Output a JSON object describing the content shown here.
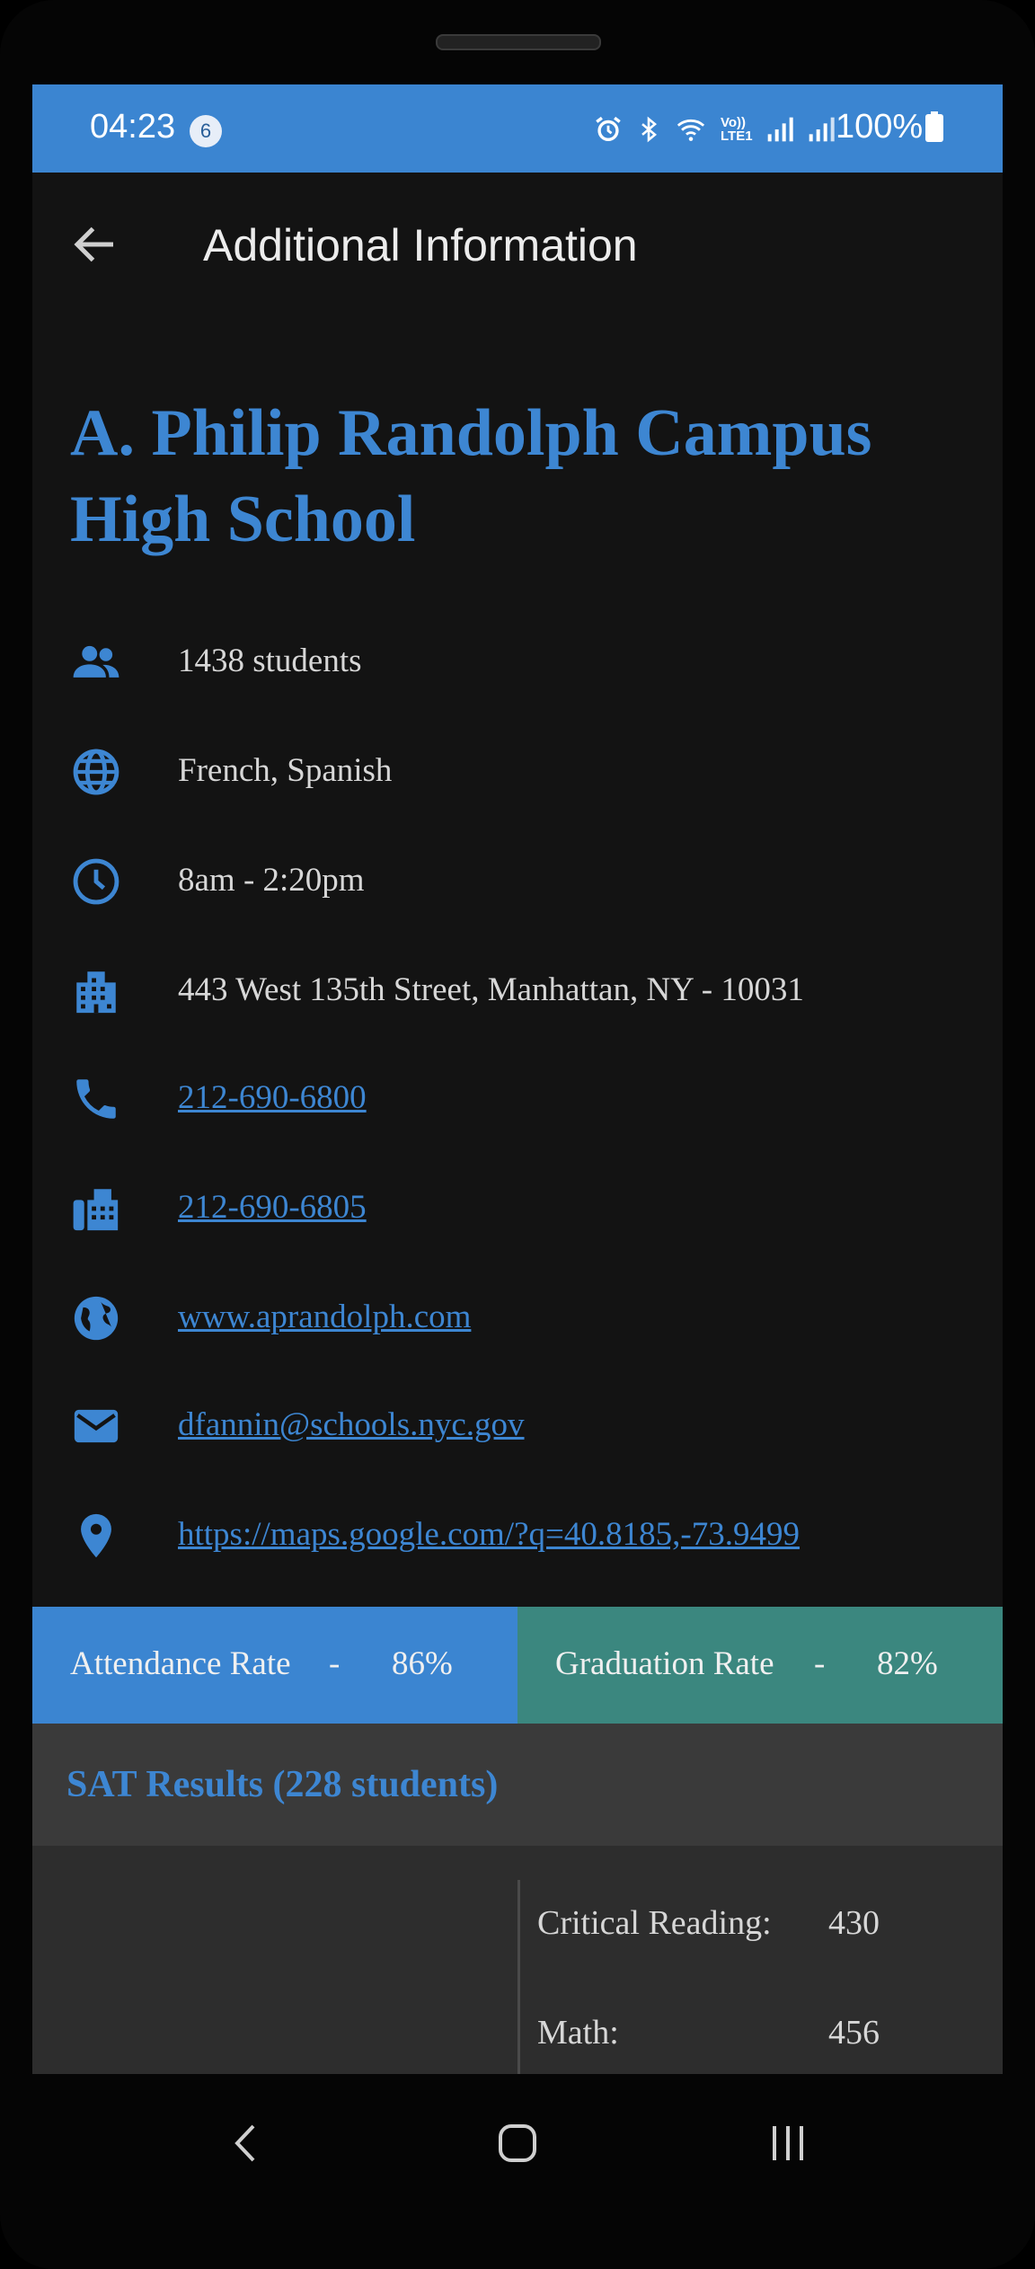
{
  "status_bar": {
    "time": "04:23",
    "notification_count": "6",
    "network_label": "Vo)) LTE1",
    "battery": "100%"
  },
  "app_bar": {
    "title": "Additional Information"
  },
  "school": {
    "name": "A. Philip Randolph Campus High School",
    "students": "1438 students",
    "languages": "French, Spanish",
    "hours": "8am - 2:20pm",
    "address": "443 West 135th Street, Manhattan, NY - 10031",
    "phone": "212-690-6800",
    "fax": "212-690-6805",
    "website": "www.aprandolph.com",
    "email": "dfannin@schools.nyc.gov",
    "map_link": "https://maps.google.com/?q=40.8185,-73.9499"
  },
  "rates": {
    "attendance_label": "Attendance Rate",
    "attendance_value": "86%",
    "graduation_label": "Graduation Rate",
    "graduation_value": "82%",
    "separator": "-"
  },
  "sat": {
    "title": "SAT Results (228 students)",
    "reading_label": "Critical Reading:",
    "reading_value": "430",
    "math_label": "Math:",
    "math_value": "456"
  },
  "colors": {
    "accent_blue": "#3b85d1",
    "accent_teal": "#3b877f",
    "background": "#131313"
  },
  "icons": [
    "people-icon",
    "globe-icon",
    "clock-icon",
    "building-icon",
    "phone-icon",
    "fax-icon",
    "web-icon",
    "email-icon",
    "location-icon"
  ]
}
